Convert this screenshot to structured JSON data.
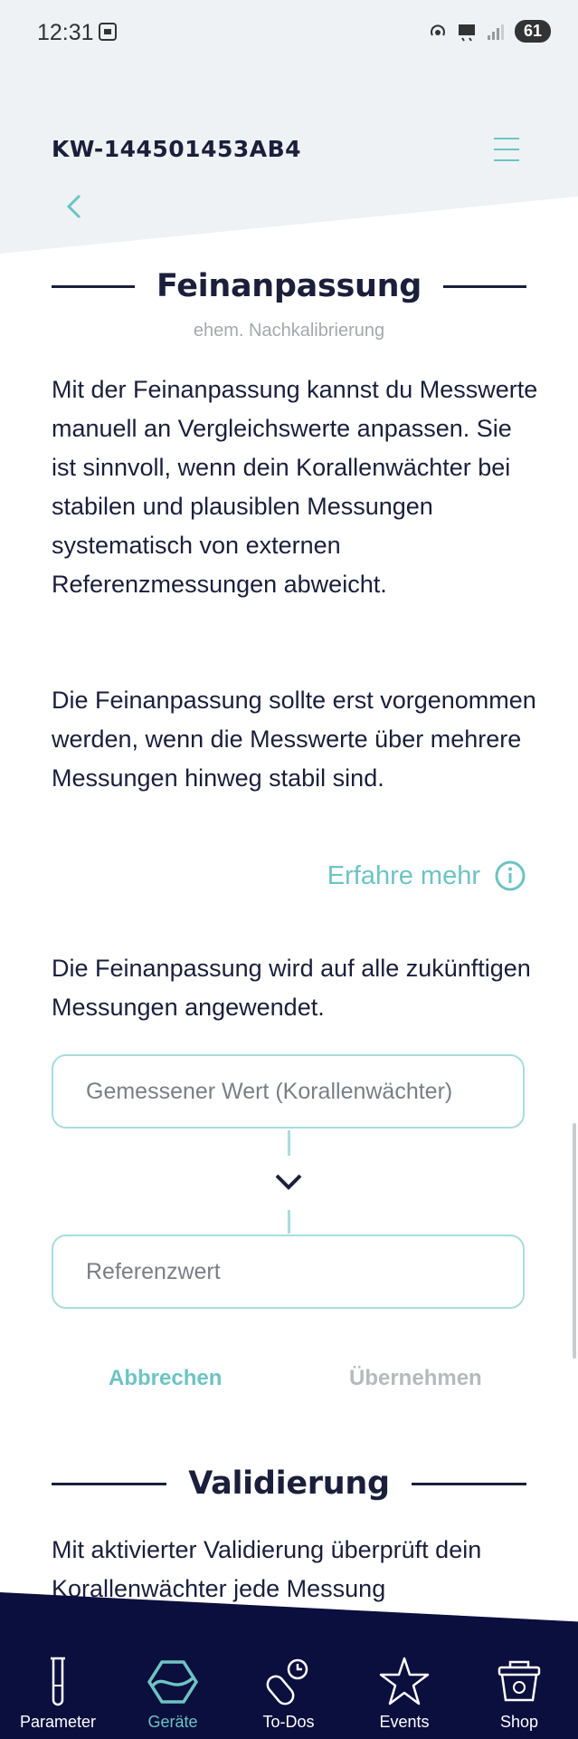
{
  "status_bar": {
    "time": "12:31",
    "battery": "61"
  },
  "header": {
    "device_id": "KW-144501453AB4"
  },
  "fine_tuning": {
    "title": "Feinanpassung",
    "subtitle": "ehem. Nachkalibrierung",
    "paragraph1": "Mit der Feinanpassung kannst du Messwerte manuell an Vergleichswerte anpassen. Sie ist sinnvoll, wenn dein Korallenwächter bei stabilen und plausiblen Messungen systematisch von externen Referenzmessungen abweicht.",
    "paragraph2": "Die Feinanpassung sollte erst vorgenommen werden, wenn die Messwerte über mehrere Messungen hinweg stabil sind.",
    "learn_more": "Erfahre mehr",
    "paragraph3": "Die Feinanpassung wird auf alle zukünftigen Messungen angewendet.",
    "measured_placeholder": "Gemessener Wert (Korallenwächter)",
    "reference_placeholder": "Referenzwert",
    "cancel_label": "Abbrechen",
    "apply_label": "Übernehmen"
  },
  "validation": {
    "title": "Validierung",
    "paragraph": "Mit aktivierter Validierung überprüft dein Korallenwächter jede Messung"
  },
  "nav": {
    "items": [
      {
        "label": "Parameter",
        "icon": "test-tube-icon"
      },
      {
        "label": "Geräte",
        "icon": "device-icon",
        "active": true
      },
      {
        "label": "To-Dos",
        "icon": "todo-clock-icon"
      },
      {
        "label": "Events",
        "icon": "starfish-icon"
      },
      {
        "label": "Shop",
        "icon": "shop-basket-icon"
      }
    ]
  },
  "colors": {
    "accent": "#6ec3c3",
    "navy": "#0b0f3e",
    "text": "#1b1f3b",
    "header_bg": "#eef2f4"
  }
}
